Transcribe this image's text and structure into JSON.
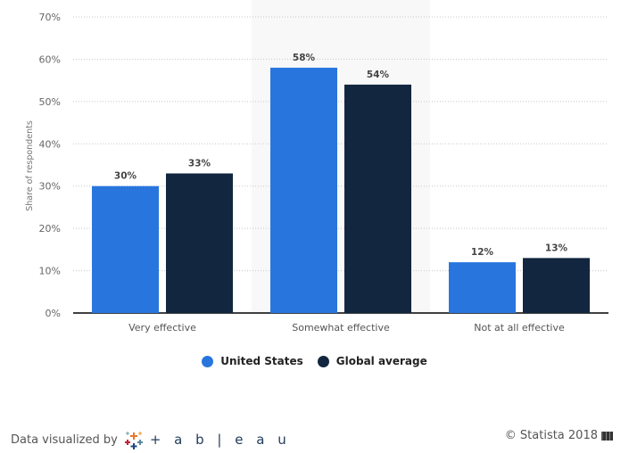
{
  "chart_data": {
    "type": "bar",
    "title": "",
    "xlabel": "",
    "ylabel": "Share of respondents",
    "categories": [
      "Very effective",
      "Somewhat effective",
      "Not at all effective"
    ],
    "series": [
      {
        "name": "United States",
        "color": "#2876dd",
        "values": [
          30,
          58,
          12
        ]
      },
      {
        "name": "Global average",
        "color": "#12263f",
        "values": [
          33,
          54,
          13
        ]
      }
    ],
    "ylim": [
      0,
      70
    ],
    "yticks": [
      0,
      10,
      20,
      30,
      40,
      50,
      60,
      70
    ],
    "ytick_labels": [
      "0%",
      "10%",
      "20%",
      "30%",
      "40%",
      "50%",
      "60%",
      "70%"
    ],
    "value_suffix": "%",
    "grid": true,
    "highlighted_category": "Somewhat effective",
    "legend_position": "bottom-center"
  },
  "legend": [
    {
      "label": "United States",
      "color": "#2876dd"
    },
    {
      "label": "Global average",
      "color": "#12263f"
    }
  ],
  "footer": {
    "credit_text": "Data visualized by",
    "brand": "+ a b | e a u",
    "copyright": "© Statista 2018"
  }
}
